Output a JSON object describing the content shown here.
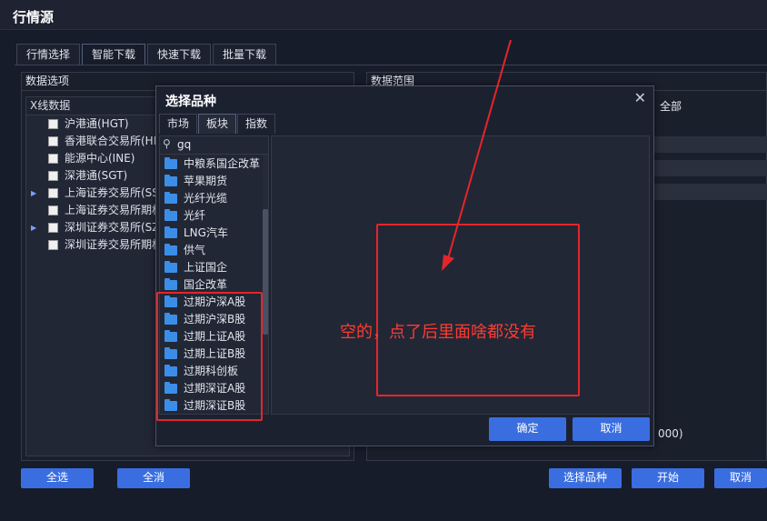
{
  "window": {
    "title": "行情源"
  },
  "tabs": [
    "行情选择",
    "智能下载",
    "快速下载",
    "批量下载"
  ],
  "left": {
    "header": "数据选项",
    "tree_header": "Ⅹ线数据",
    "rows": [
      {
        "label": "沪港通(HGT)",
        "arrow": false
      },
      {
        "label": "香港联合交易所(HK",
        "arrow": false
      },
      {
        "label": "能源中心(INE)",
        "arrow": false
      },
      {
        "label": "深港通(SGT)",
        "arrow": false
      },
      {
        "label": "上海证券交易所(SS",
        "arrow": true
      },
      {
        "label": "上海证券交易所期权",
        "arrow": false
      },
      {
        "label": "深圳证券交易所(SZ",
        "arrow": true
      },
      {
        "label": "深圳证券交易所期权",
        "arrow": false
      }
    ]
  },
  "right": {
    "header": "数据范围",
    "all_label": "全部",
    "tail_text": "000)"
  },
  "buttons": {
    "select_all": "全选",
    "deselect_all": "全消",
    "select_variety": "选择品种",
    "start": "开始",
    "cancel": "取消"
  },
  "dialog": {
    "title": "选择品种",
    "close": "✕",
    "tabs": [
      "市场",
      "板块",
      "指数"
    ],
    "search_value": "gq",
    "items": [
      "中粮系国企改革",
      "苹果期货",
      "光纤光缆",
      "光纤",
      "LNG汽车",
      "供气",
      "上证国企",
      "国企改革",
      "过期沪深A股",
      "过期沪深B股",
      "过期上证A股",
      "过期上证B股",
      "过期科创板",
      "过期深证A股",
      "过期深证B股"
    ],
    "ok": "确定",
    "cancel": "取消"
  },
  "annotation": {
    "note": "空的，点了后里面啥都没有",
    "color": "#e5252a"
  }
}
